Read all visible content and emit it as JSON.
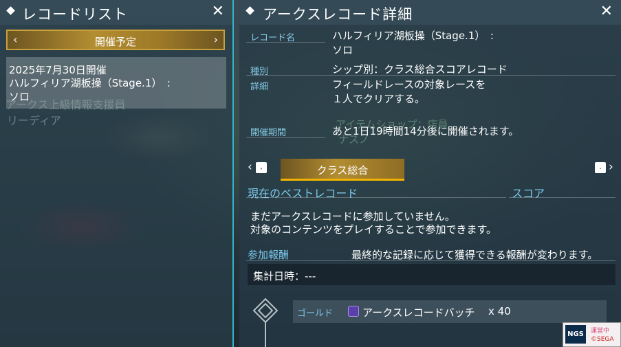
{
  "left_panel": {
    "title": "レコードリスト",
    "tab_label": "開催予定",
    "tab_prev": "‹",
    "tab_next": "›",
    "record": {
      "date": "2025年7月30日開催",
      "name": "ハルフィリア湖板操（Stage.1）　:",
      "mode": "ソロ"
    },
    "bg_npc_name": "アークス上級情報支援員",
    "bg_npc_sub": "リーディア"
  },
  "right_panel": {
    "title": "アークスレコード詳細",
    "record_name_label": "レコード名",
    "record_name_line1": "ハルフィリア湖板操（Stage.1）　:",
    "record_name_line2": "ソロ",
    "type_label": "種別",
    "type_value": "シップ別：クラス総合スコアレコード",
    "detail_label": "詳細",
    "detail_line1": "フィールドレースの対象レースを",
    "detail_line2": "１人でクリアする。",
    "period_label": "開催期間",
    "period_value": "あと1日19時間14分後に開催されます。",
    "bg_shop_name": "アイテムショップ：店員",
    "bg_shop_sub": "ナスノ",
    "class_tab": "クラス総合",
    "key_left": ",",
    "key_right": ".",
    "best_record_label": "現在のベストレコード",
    "score_label": "スコア",
    "no_participation_line1": "まだアークスレコードに参加していません。",
    "no_participation_line2": "対象のコンテンツをプレイすることで参加できます。",
    "reward_label": "参加報酬",
    "reward_note": "最終的な記録に応じて獲得できる報酬が変わります。",
    "tally_date": "集計日時：---",
    "reward_rank": "ゴールド",
    "reward_item": "アークスレコードバッチ",
    "reward_qty": "x  40"
  },
  "logo": {
    "badge": "NGS",
    "text1": "運営中",
    "text2": "©SEGA"
  },
  "colors": {
    "accent_gold": "#b38d31",
    "accent_cyan": "#2fb6c8",
    "label_blue": "#7cc8ea",
    "underline_yellow": "#f2b400"
  }
}
